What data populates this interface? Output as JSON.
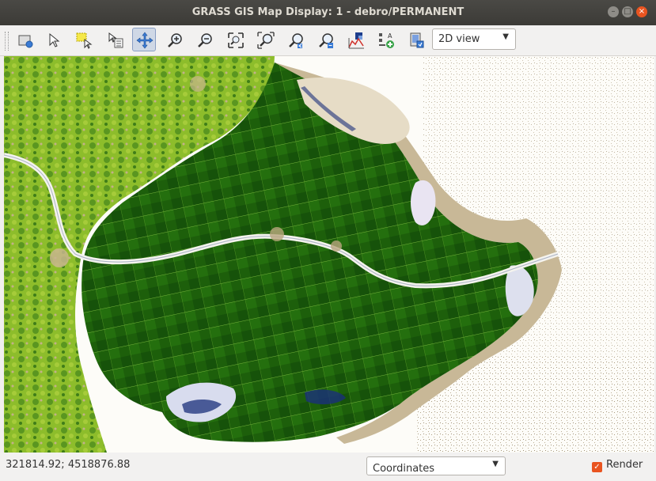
{
  "window": {
    "title": "GRASS GIS Map Display: 1 - debro/PERMANENT",
    "minimize_glyph": "–",
    "maximize_glyph": "□",
    "close_glyph": "×"
  },
  "toolbar": {
    "tools": [
      {
        "name": "display-map-icon"
      },
      {
        "name": "pointer-icon"
      },
      {
        "name": "select-icon"
      },
      {
        "name": "query-icon"
      },
      {
        "name": "pan-icon",
        "active": true
      },
      {
        "name": "zoom-in-icon"
      },
      {
        "name": "zoom-out-icon"
      },
      {
        "name": "zoom-extent-icon"
      },
      {
        "name": "zoom-back-icon"
      },
      {
        "name": "zoom-options-icon"
      },
      {
        "name": "zoom-menu-icon"
      },
      {
        "name": "analyze-icon"
      },
      {
        "name": "overlay-icon"
      },
      {
        "name": "save-image-icon"
      }
    ],
    "view_mode": {
      "selected": "2D view",
      "arrow": "▼"
    }
  },
  "statusbar": {
    "coordinates": "321814.92; 4518876.88",
    "mode": {
      "selected": "Coordinates",
      "arrow": "▼"
    },
    "render": {
      "label": "Render",
      "checked": true,
      "check_glyph": "✓"
    }
  },
  "colors": {
    "accent": "#e95420",
    "titlebar": "#3c3b37",
    "map_background": "#fdfcf8",
    "dense_vegetation": "#1e6b0a",
    "light_vegetation": "#8fbf2a",
    "water": "#1a2f7a",
    "sand": "#bfae90"
  }
}
